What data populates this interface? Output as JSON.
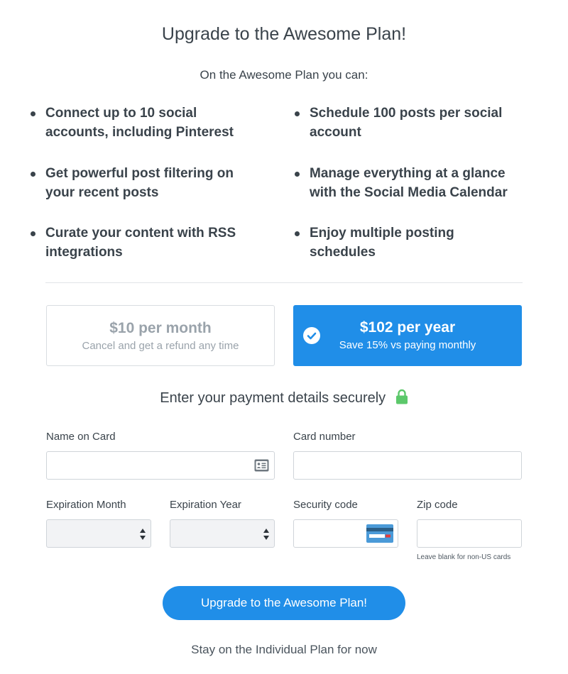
{
  "header": {
    "title": "Upgrade to the Awesome Plan!",
    "subtitle": "On the Awesome Plan you can:"
  },
  "features": [
    "Connect up to 10 social accounts, including Pinterest",
    "Schedule 100 posts per social account",
    "Get powerful post filtering on your recent posts",
    "Manage everything at a glance with the Social Media Calendar",
    "Curate your content with RSS integrations",
    "Enjoy multiple posting schedules"
  ],
  "plans": {
    "monthly": {
      "name": "$10 per month",
      "note": "Cancel and get a refund any time",
      "selected": false
    },
    "yearly": {
      "name": "$102 per year",
      "note": "Save 15% vs paying monthly",
      "selected": true
    }
  },
  "payment": {
    "heading": "Enter your payment details securely",
    "name_label": "Name on Card",
    "name_value": "",
    "card_label": "Card number",
    "card_value": "",
    "exp_month_label": "Expiration Month",
    "exp_month_value": "",
    "exp_year_label": "Expiration Year",
    "exp_year_value": "",
    "security_label": "Security code",
    "security_value": "",
    "zip_label": "Zip code",
    "zip_value": "",
    "zip_hint": "Leave blank for non-US cards"
  },
  "actions": {
    "upgrade": "Upgrade to the Awesome Plan!",
    "stay": "Stay on the Individual Plan for now"
  },
  "icons": {
    "contact_card": "contact-card-icon",
    "credit_card": "credit-card-icon",
    "lock": "lock-icon",
    "check": "check-circle-icon",
    "select_arrows": "sort-arrows-icon"
  },
  "colors": {
    "accent": "#208ee8",
    "lock": "#5cc86b",
    "text": "#3a434b"
  }
}
